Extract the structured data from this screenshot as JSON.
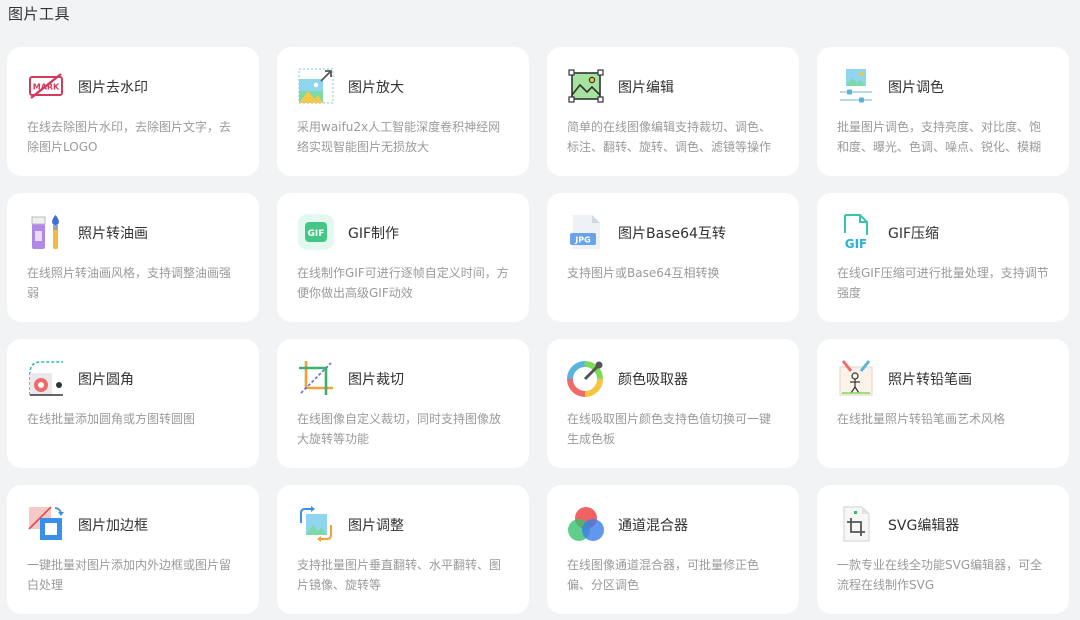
{
  "section_title": "图片工具",
  "tools": [
    {
      "name": "图片去水印",
      "desc": "在线去除图片水印，去除图片文字，去除图片LOGO",
      "icon": "watermark-remove-icon",
      "icon_text": "MARK"
    },
    {
      "name": "图片放大",
      "desc": "采用waifu2x人工智能深度卷积神经网络实现智能图片无损放大",
      "icon": "image-enlarge-icon"
    },
    {
      "name": "图片编辑",
      "desc": "简单的在线图像编辑支持裁切、调色、标注、翻转、旋转、调色、滤镜等操作",
      "icon": "image-edit-icon"
    },
    {
      "name": "图片调色",
      "desc": "批量图片调色，支持亮度、对比度、饱和度、曝光、色调、噪点、锐化、模糊等调",
      "icon": "color-adjust-icon"
    },
    {
      "name": "照片转油画",
      "desc": "在线照片转油画风格，支持调整油画强弱",
      "icon": "oil-paint-icon"
    },
    {
      "name": "GIF制作",
      "desc": "在线制作GIF可进行逐帧自定义时间，方便你做出高级GIF动效",
      "icon": "gif-make-icon",
      "icon_text": "GIF"
    },
    {
      "name": "图片Base64互转",
      "desc": "支持图片或Base64互相转换",
      "icon": "base64-icon",
      "icon_text": "JPG"
    },
    {
      "name": "GIF压缩",
      "desc": "在线GIF压缩可进行批量处理，支持调节强度",
      "icon": "gif-compress-icon",
      "icon_text": "GIF"
    },
    {
      "name": "图片圆角",
      "desc": "在线批量添加圆角或方图转圆图",
      "icon": "round-corner-icon"
    },
    {
      "name": "图片裁切",
      "desc": "在线图像自定义裁切，同时支持图像放大旋转等功能",
      "icon": "crop-icon"
    },
    {
      "name": "颜色吸取器",
      "desc": "在线吸取图片颜色支持色值切换可一键生成色板",
      "icon": "color-picker-icon"
    },
    {
      "name": "照片转铅笔画",
      "desc": "在线批量照片转铅笔画艺术风格",
      "icon": "pencil-sketch-icon"
    },
    {
      "name": "图片加边框",
      "desc": "一键批量对图片添加内外边框或图片留白处理",
      "icon": "add-border-icon"
    },
    {
      "name": "图片调整",
      "desc": "支持批量图片垂直翻转、水平翻转、图片镜像、旋转等",
      "icon": "image-adjust-icon"
    },
    {
      "name": "通道混合器",
      "desc": "在线图像通道混合器，可批量修正色偏、分区调色",
      "icon": "channel-mixer-icon"
    },
    {
      "name": "SVG编辑器",
      "desc": "一款专业在线全功能SVG编辑器，可全流程在线制作SVG",
      "icon": "svg-editor-icon"
    }
  ]
}
